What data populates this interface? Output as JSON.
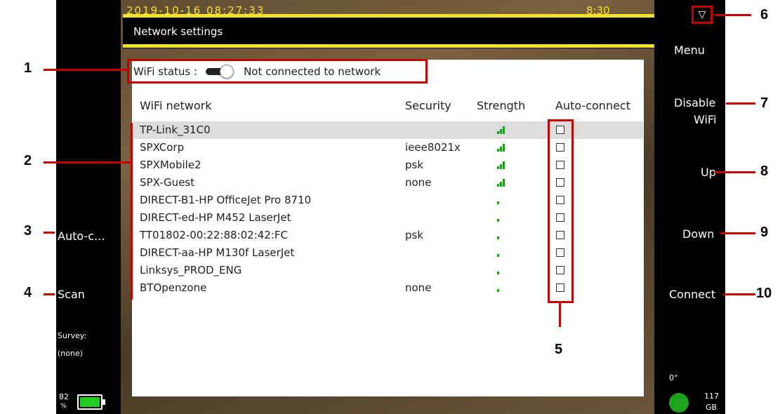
{
  "header": {
    "title": "Network settings",
    "time_left": "2019-10-16 08:27:33",
    "time_right": "8:30"
  },
  "wifi_status": {
    "label": "WiFi status :",
    "toggle_on": false,
    "status_text": "Not connected to network"
  },
  "table": {
    "columns": [
      "WiFi network",
      "Security",
      "Strength",
      "Auto-connect"
    ],
    "rows": [
      {
        "name": "TP-Link_31C0",
        "security": "",
        "strength": 3,
        "auto": false,
        "selected": true
      },
      {
        "name": "SPXCorp",
        "security": "ieee8021x",
        "strength": 3,
        "auto": false
      },
      {
        "name": "SPXMobile2",
        "security": "psk",
        "strength": 3,
        "auto": false
      },
      {
        "name": "SPX-Guest",
        "security": "none",
        "strength": 3,
        "auto": false
      },
      {
        "name": "DIRECT-B1-HP OfficeJet Pro 8710",
        "security": "",
        "strength": 1,
        "auto": false
      },
      {
        "name": "DIRECT-ed-HP M452 LaserJet",
        "security": "",
        "strength": 1,
        "auto": false
      },
      {
        "name": "TT01802-00:22:88:02:42:FC",
        "security": "psk",
        "strength": 1,
        "auto": false
      },
      {
        "name": "DIRECT-aa-HP M130f LaserJet",
        "security": "",
        "strength": 1,
        "auto": false
      },
      {
        "name": "Linksys_PROD_ENG",
        "security": "",
        "strength": 1,
        "auto": false
      },
      {
        "name": "BTOpenzone",
        "security": "none",
        "strength": 1,
        "auto": false
      }
    ]
  },
  "left_softkeys": {
    "auto_connect": "Auto-c...",
    "scan": "Scan",
    "survey_label": "Survey:",
    "survey_value": "(none)",
    "battery_pct_line1": "82",
    "battery_pct_line2": "%"
  },
  "right_softkeys": {
    "menu_icon": "▽",
    "menu": "Menu",
    "disable_line1": "Disable",
    "disable_line2": "WiFi",
    "up": "Up",
    "down": "Down",
    "connect": "Connect",
    "angle": "0°",
    "storage_line1": "117",
    "storage_line2": "GB"
  },
  "callouts": [
    "1",
    "2",
    "3",
    "4",
    "5",
    "6",
    "7",
    "8",
    "9",
    "10"
  ],
  "colors": {
    "accent_yellow": "#f2e12d",
    "annotation_red": "#c40000",
    "signal_green": "#1e9c1e",
    "selected_row": "#dcdcdc"
  }
}
